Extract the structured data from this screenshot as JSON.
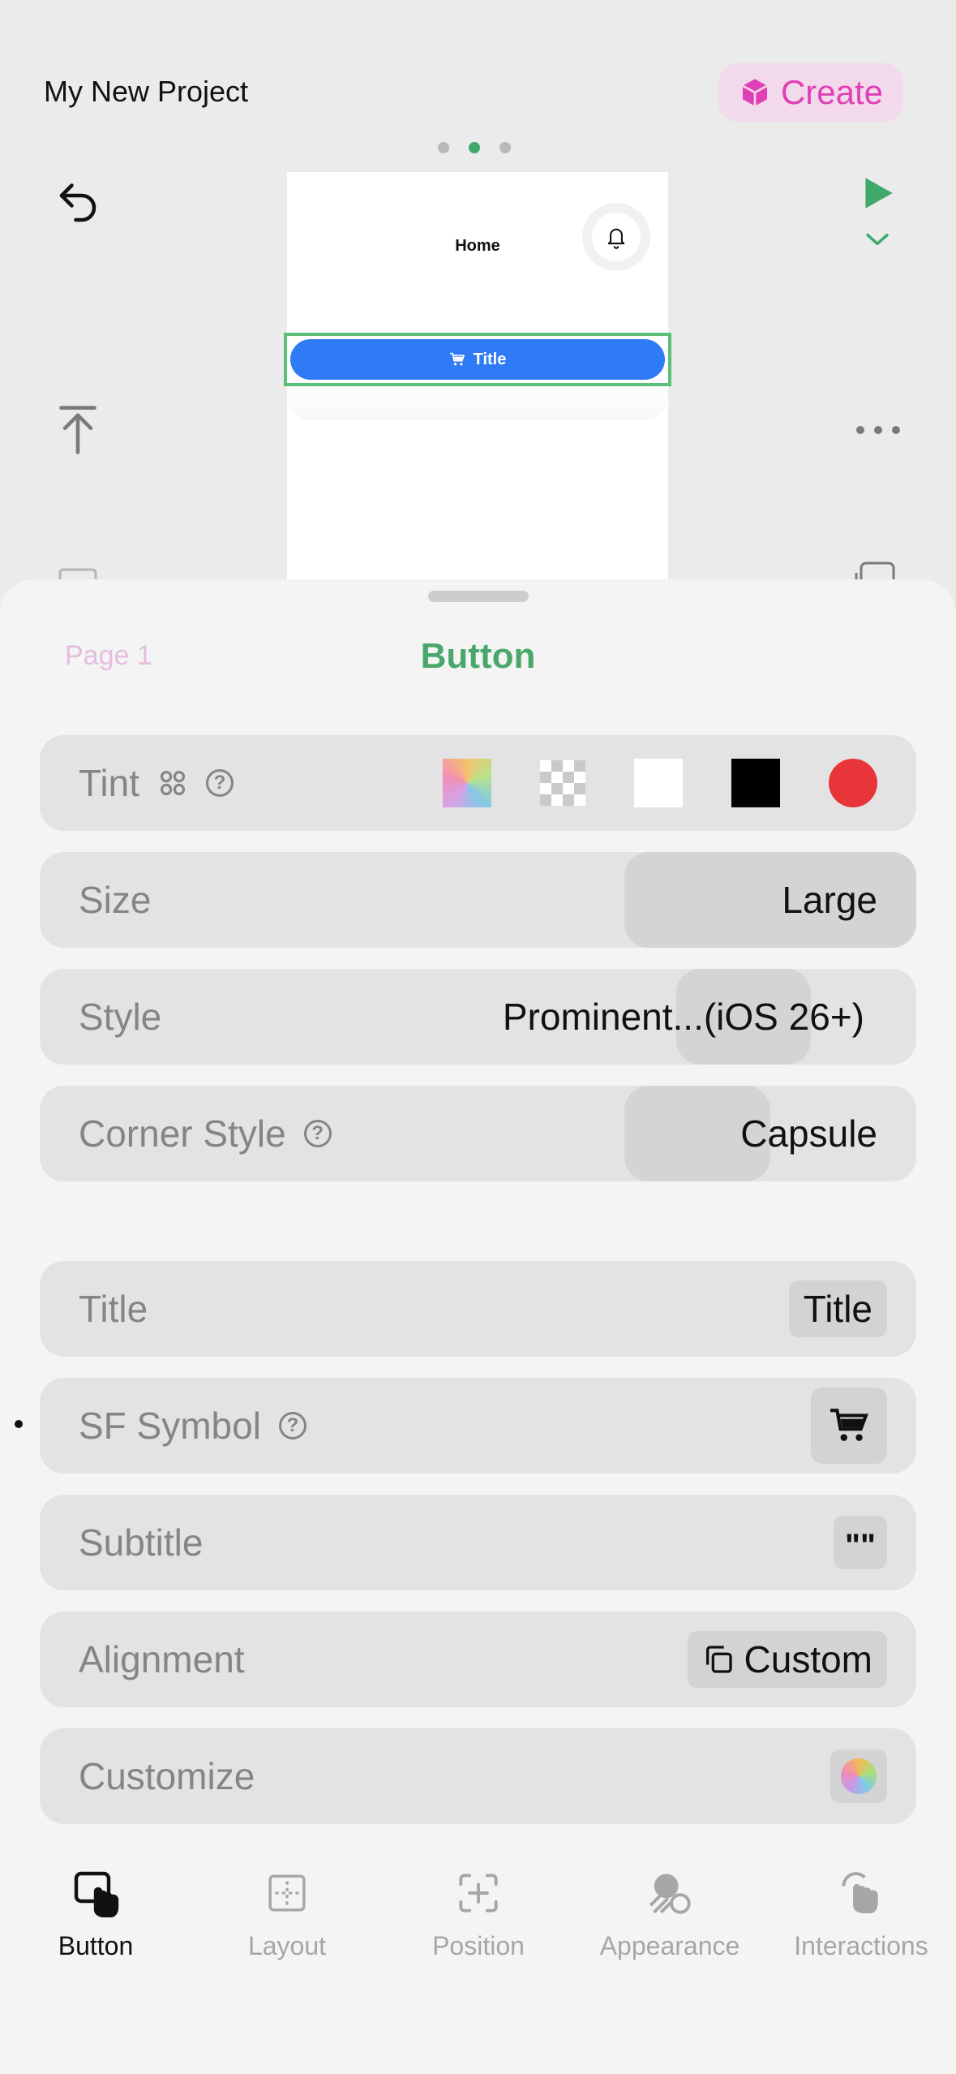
{
  "header": {
    "project_title": "My New Project",
    "create_label": "Create",
    "page_dots": 3,
    "active_page_dot": 2,
    "accent": "#e040b5"
  },
  "preview": {
    "nav_title": "Home",
    "button_title": "Title",
    "button_color": "#2f7bf5",
    "selection_color": "#5dc07a"
  },
  "sheet": {
    "page_label": "Page 1",
    "title": "Button",
    "rows": {
      "tint": {
        "label": "Tint",
        "swatches": [
          "multicolor",
          "clear",
          "white",
          "black",
          "red"
        ]
      },
      "size": {
        "label": "Size",
        "value": "Large"
      },
      "style": {
        "label": "Style",
        "value": "Prominent...(iOS 26+)"
      },
      "corner_style": {
        "label": "Corner Style",
        "value": "Capsule"
      },
      "title": {
        "label": "Title",
        "value": "Title"
      },
      "sf_symbol": {
        "label": "SF Symbol",
        "icon": "cart-icon"
      },
      "subtitle": {
        "label": "Subtitle",
        "value": "\"\""
      },
      "alignment": {
        "label": "Alignment",
        "value": "Custom"
      },
      "customize": {
        "label": "Customize",
        "icon": "color-wheel-icon"
      }
    }
  },
  "tabbar": {
    "tabs": [
      {
        "label": "Button",
        "icon": "button-pointer-icon",
        "active": true
      },
      {
        "label": "Layout",
        "icon": "layout-icon",
        "active": false
      },
      {
        "label": "Position",
        "icon": "position-icon",
        "active": false
      },
      {
        "label": "Appearance",
        "icon": "appearance-icon",
        "active": false
      },
      {
        "label": "Interactions",
        "icon": "interactions-icon",
        "active": false
      }
    ]
  }
}
